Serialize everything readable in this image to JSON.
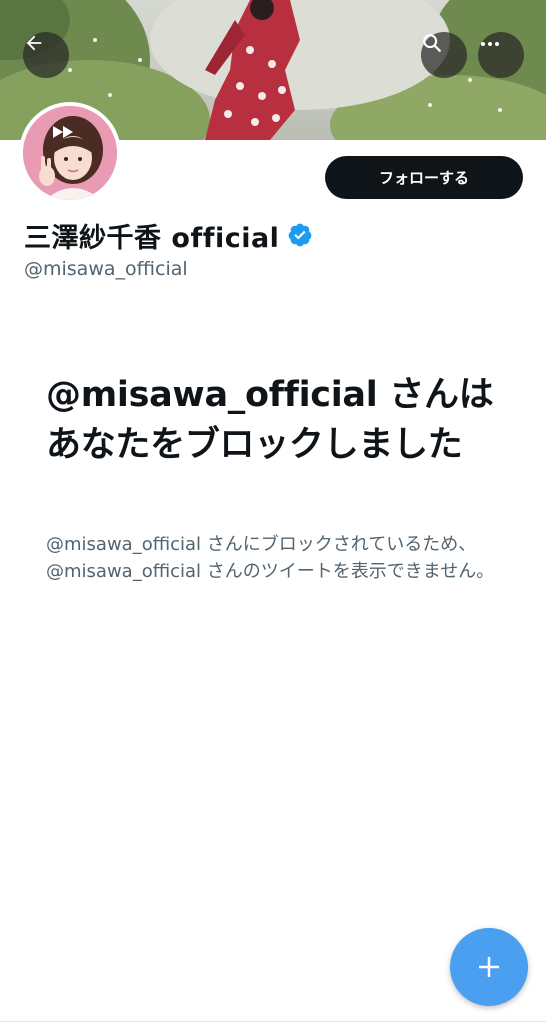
{
  "header": {
    "back_icon": "arrow-left-icon",
    "search_icon": "search-icon",
    "more_icon": "more-horizontal-icon"
  },
  "profile": {
    "display_name": "三澤紗千香 official",
    "handle": "@misawa_official",
    "verified": true,
    "follow_label": "フォローする"
  },
  "blocked": {
    "title": "@misawa_official さんはあなたをブロックしました",
    "description": "@misawa_official さんにブロックされているため、@misawa_official さんのツイートを表示できません。"
  },
  "fab": {
    "icon": "plus-icon"
  },
  "colors": {
    "accent": "#4a9ff0",
    "verified": "#1d9bf0",
    "follow_button": "#0f1419",
    "secondary_text": "#536471"
  }
}
